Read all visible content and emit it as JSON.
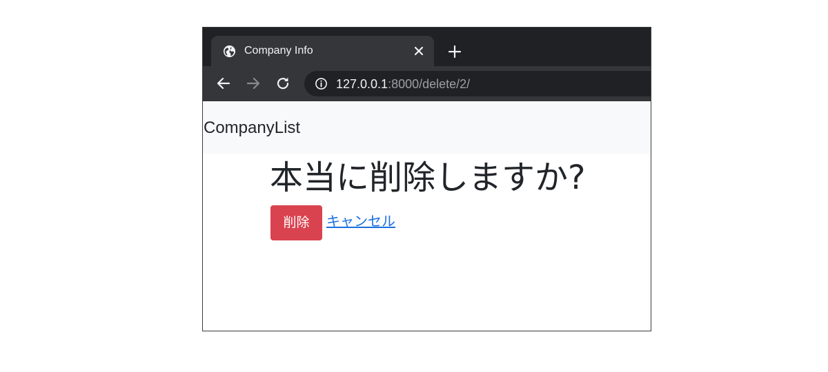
{
  "browser": {
    "tab_title": "Company Info",
    "url_host": "127.0.0.1",
    "url_rest": ":8000/delete/2/"
  },
  "navbar": {
    "brand": "CompanyList"
  },
  "main": {
    "heading": "本当に削除しますか?",
    "delete_label": "削除",
    "cancel_label": "キャンセル"
  },
  "colors": {
    "tab_strip": "#202124",
    "toolbar": "#35363a",
    "danger": "#d9434f",
    "link": "#1a6fe0",
    "navbar_bg": "#f8f9fa"
  },
  "icons": {
    "favicon": "globe-icon",
    "tab_close": "close-icon",
    "new_tab": "plus-icon",
    "back": "arrow-left-icon",
    "forward": "arrow-right-icon",
    "reload": "reload-icon",
    "site_info": "info-icon"
  }
}
